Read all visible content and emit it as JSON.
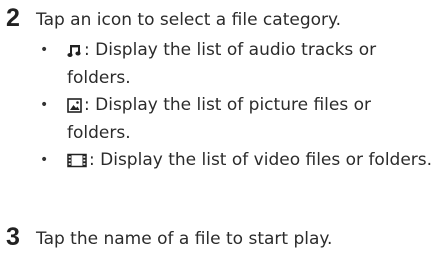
{
  "steps": [
    {
      "number": "2",
      "text": "Tap an icon to select a file category.",
      "bullets": [
        {
          "icon": "music-note-icon",
          "text": ": Display the list of audio tracks or folders."
        },
        {
          "icon": "picture-icon",
          "text": ": Display the list of picture files or folders."
        },
        {
          "icon": "film-icon",
          "text": ": Display the list of video files or folders."
        }
      ]
    },
    {
      "number": "3",
      "text": "Tap the name of a file to start play."
    }
  ]
}
